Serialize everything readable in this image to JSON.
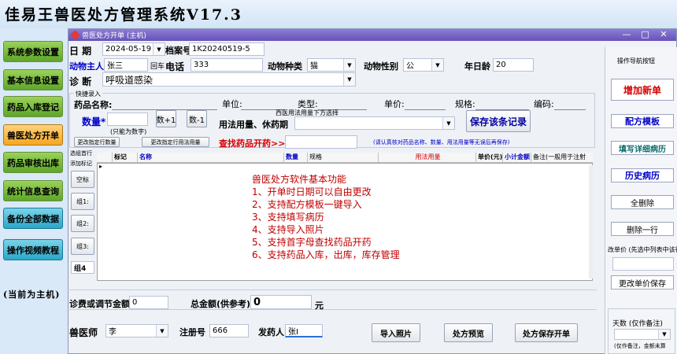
{
  "app_title": "佳易王兽医处方管理系统V17.3",
  "sidebar": {
    "items": [
      "系统参数设置",
      "基本信息设置",
      "药品入库登记",
      "兽医处方开单",
      "药品审核出库",
      "统计信息查询",
      "备份全部数据",
      "操作视频教程"
    ],
    "note": "(当前为主机)"
  },
  "window": {
    "title": "兽医处方开单 (主机)",
    "controls": [
      "—",
      "□",
      "✕"
    ]
  },
  "form": {
    "date_label": "日 期",
    "date_value": "2024-05-19",
    "file_no_label": "档案号",
    "file_no_value": "1K20240519-5",
    "owner_label": "动物主人",
    "owner_value": "张三",
    "return_label": "回车",
    "phone_label": "电话",
    "phone_value": "333",
    "species_label": "动物种类",
    "species_value": "猫",
    "sex_label": "动物性别",
    "sex_value": "公",
    "age_label": "年日龄",
    "age_value": "20",
    "diag_label": "诊 断",
    "diag_value": "呼吸道感染"
  },
  "quick": {
    "group_label": "快捷录入",
    "drug_name_label": "药品名称:",
    "unit_label": "单位:",
    "type_label": "类型:",
    "price_label": "单价:",
    "spec_label": "规格:",
    "code_label": "编码:",
    "qty_label": "数量*",
    "qty_note": "(只能为数字)",
    "plus1": "数+1",
    "minus1": "数-1",
    "usage_hint": "西医用法用量下方选择",
    "usage_label": "用法用量、休药期",
    "save_record": "保存该条记录",
    "change_qty": "更改指定行数量",
    "change_usage": "更改指定行用法用量",
    "find_drug": "查找药品开药>>>",
    "find_note": "(请认真核对药品名称、数量、用法用量等无误后再保存)"
  },
  "grid": {
    "left_labels": [
      "选组首行",
      "添加标记"
    ],
    "left_buttons": [
      "空标",
      "组1:",
      "组2:",
      "组3:",
      "组4"
    ],
    "columns": [
      "标记",
      "名称",
      "数量",
      "规格",
      "用法用量",
      "单价(元)",
      "小计金额",
      "备注(一般用于注射"
    ],
    "marker": "▸"
  },
  "features": {
    "title": "兽医处方软件基本功能",
    "lines": [
      "1、开单时日期可以自由更改",
      "2、支持配方模板一键导入",
      "3、支持填写病历",
      "4、支持导入照片",
      "5、支持首字母查找药品开药",
      "6、支持药品入库，出库，库存管理"
    ]
  },
  "totals": {
    "fee_label": "诊费或调节金额",
    "fee_value": "0",
    "total_label": "总金额(供参考)",
    "total_value": "0",
    "unit": "元"
  },
  "bottom": {
    "vet_label": "兽医师",
    "vet_value": "李",
    "reg_label": "注册号",
    "reg_value": "666",
    "dispenser_label": "发药人",
    "dispenser_value": "张I",
    "import_photo": "导入照片",
    "preview": "处方预览",
    "save_open": "处方保存开单"
  },
  "right": {
    "group_label": "操作导航按钮",
    "add_new": "增加新单",
    "template": "配方模板",
    "history_fill": "填写详细病历",
    "history": "历史病历",
    "delete_all": "全删除",
    "delete_row": "删除一行",
    "price_note": "改单价 (先选中列表中该行",
    "save_price": "更改单价保存",
    "days_label": "天数 (仅作备注)",
    "days_note": "(仅作备注，金额未算"
  },
  "colors": {
    "title_bar": "#6752b8",
    "red": "#d40000",
    "blue": "#0000c8",
    "green_btn": "#5ea62a"
  }
}
